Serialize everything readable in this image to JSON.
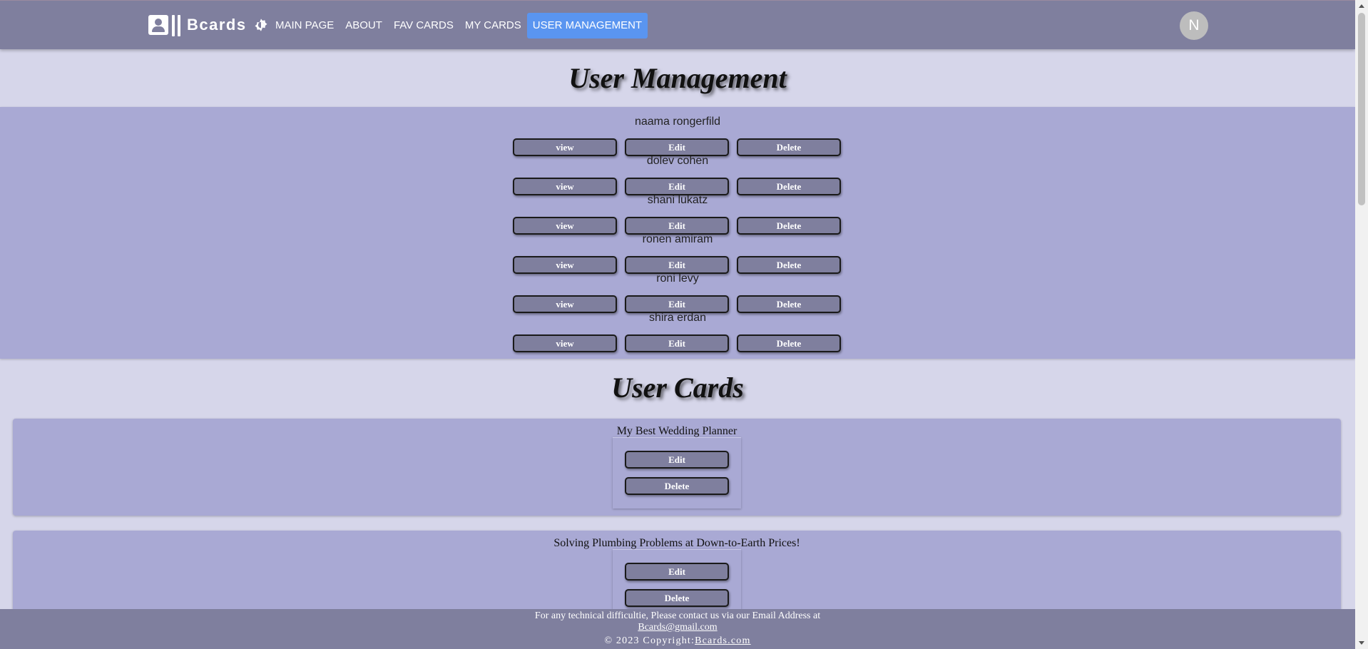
{
  "header": {
    "brand": "Bcards",
    "nav": [
      "MAIN PAGE",
      "ABOUT",
      "FAV CARDS",
      "MY CARDS",
      "USER MANAGEMENT"
    ],
    "active_nav": "USER MANAGEMENT",
    "avatar_initial": "N"
  },
  "users_section": {
    "title": "User Management",
    "users": [
      {
        "name": "naama rongerfild",
        "view": "view",
        "edit": "Edit",
        "delete": "Delete"
      },
      {
        "name": "dolev cohen",
        "view": "view",
        "edit": "Edit",
        "delete": "Delete"
      },
      {
        "name": "shani lukatz",
        "view": "view",
        "edit": "Edit",
        "delete": "Delete"
      },
      {
        "name": "ronen amiram",
        "view": "view",
        "edit": "Edit",
        "delete": "Delete"
      },
      {
        "name": "roni levy",
        "view": "view",
        "edit": "Edit",
        "delete": "Delete"
      },
      {
        "name": "shira erdan",
        "view": "view",
        "edit": "Edit",
        "delete": "Delete"
      }
    ]
  },
  "cards_section": {
    "title": "User Cards",
    "cards": [
      {
        "title": "My Best Wedding Planner",
        "edit": "Edit",
        "delete": "Delete"
      },
      {
        "title": "Solving Plumbing Problems at Down-to-Earth Prices!",
        "edit": "Edit",
        "delete": "Delete"
      }
    ]
  },
  "footer": {
    "contact_text": "For any technical difficultie, Please contact us via our Email Address at",
    "email": "Bcards@gmail.com",
    "copyright_prefix": "© 2023 Copyright:",
    "site": "Bcards.com"
  },
  "colors": {
    "header_bg": "#7f7f9e",
    "page_bg": "#d6d6ea",
    "section_bg": "#a9a9d4",
    "active_nav_bg": "#5a95f0",
    "avatar_bg": "#bdbdbd"
  },
  "icons": [
    "account-box-icon",
    "theme-toggle-icon"
  ]
}
